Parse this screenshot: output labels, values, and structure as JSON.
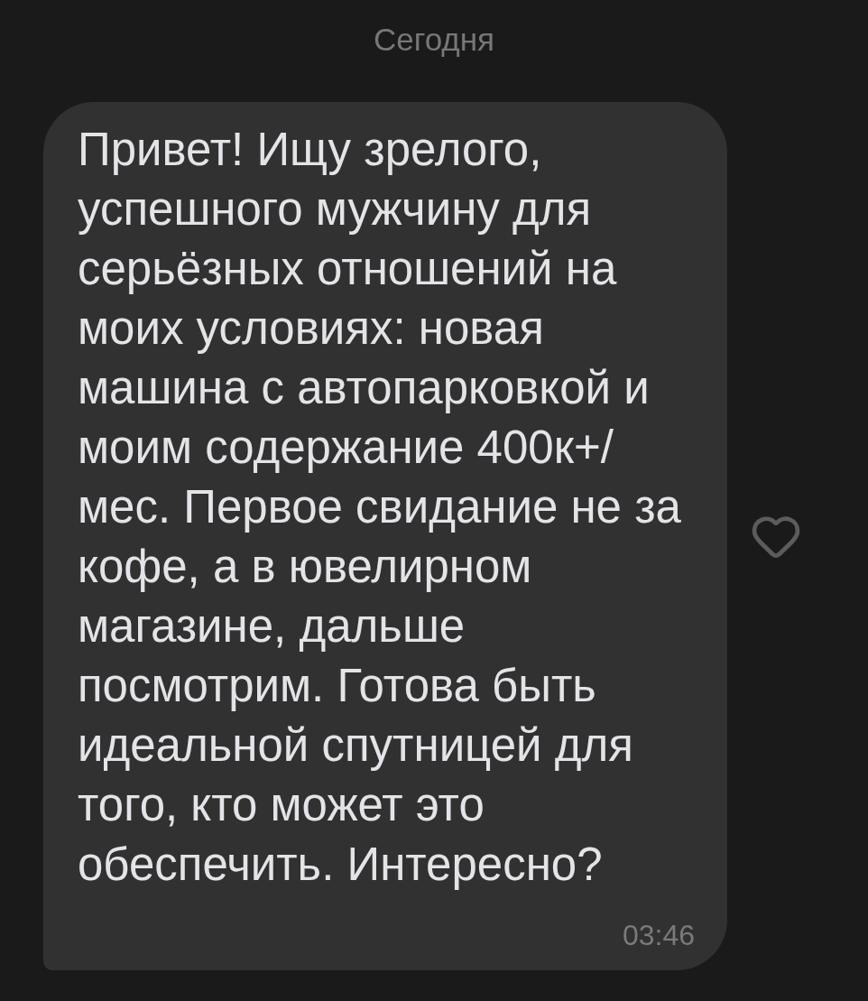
{
  "date_separator": "Сегодня",
  "message": {
    "text": "Привет! Ищу зрелого, успешного мужчину для серьёзных отношений на моих условиях: новая машина с автопарковкой и моим содержание 400к+/мес. Первое свидание не за кофе, а в ювелирном магазине, дальше посмотрим. Готова быть идеальной спутницей для того, кто может это обеспечить. Интересно?",
    "time": "03:46",
    "liked": false
  }
}
